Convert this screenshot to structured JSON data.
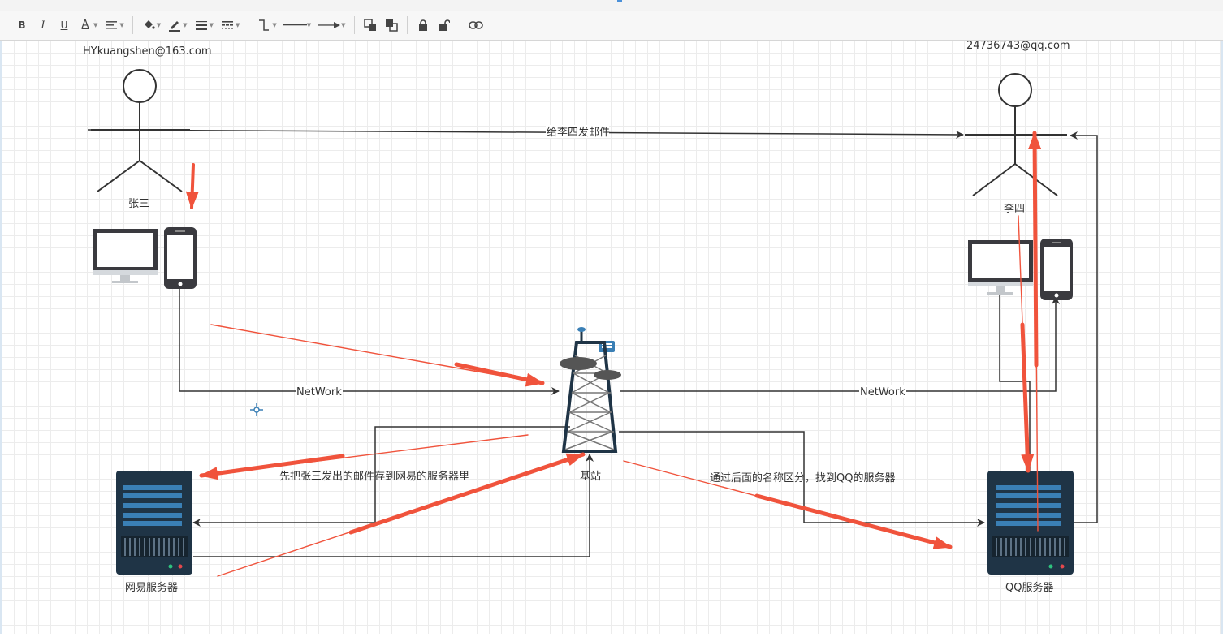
{
  "toolbar": {
    "buttons": [
      "B",
      "I",
      "U",
      "A"
    ],
    "icons": [
      "bold-icon",
      "italic-icon",
      "underline-icon",
      "font-color-icon",
      "align-icon",
      "fill-color-icon",
      "line-color-icon",
      "line-weight-icon",
      "line-style-icon",
      "connector-icon",
      "line-type-icon",
      "arrow-style-icon",
      "bring-front-icon",
      "send-back-icon",
      "lock-icon",
      "unlock-icon",
      "link-icon"
    ]
  },
  "diagram": {
    "sender_email": "HYkuangshen@163.com",
    "receiver_email": "24736743@qq.com",
    "sender_name": "张三",
    "receiver_name": "李四",
    "send_mail_label": "给李四发邮件",
    "network_left": "NetWork",
    "network_right": "NetWork",
    "tower_label": "基站",
    "store_label": "先把张三发出的邮件存到网易的服务器里",
    "route_label": "通过后面的名称区分，找到QQ的服务器",
    "server_left": "网易服务器",
    "server_right": "QQ服务器"
  },
  "colors": {
    "annotation_red": "#f0533c",
    "line": "#333333",
    "server_body": "#1f3446",
    "server_accent": "#3a7fb5",
    "device_frame": "#3a3a3f"
  }
}
